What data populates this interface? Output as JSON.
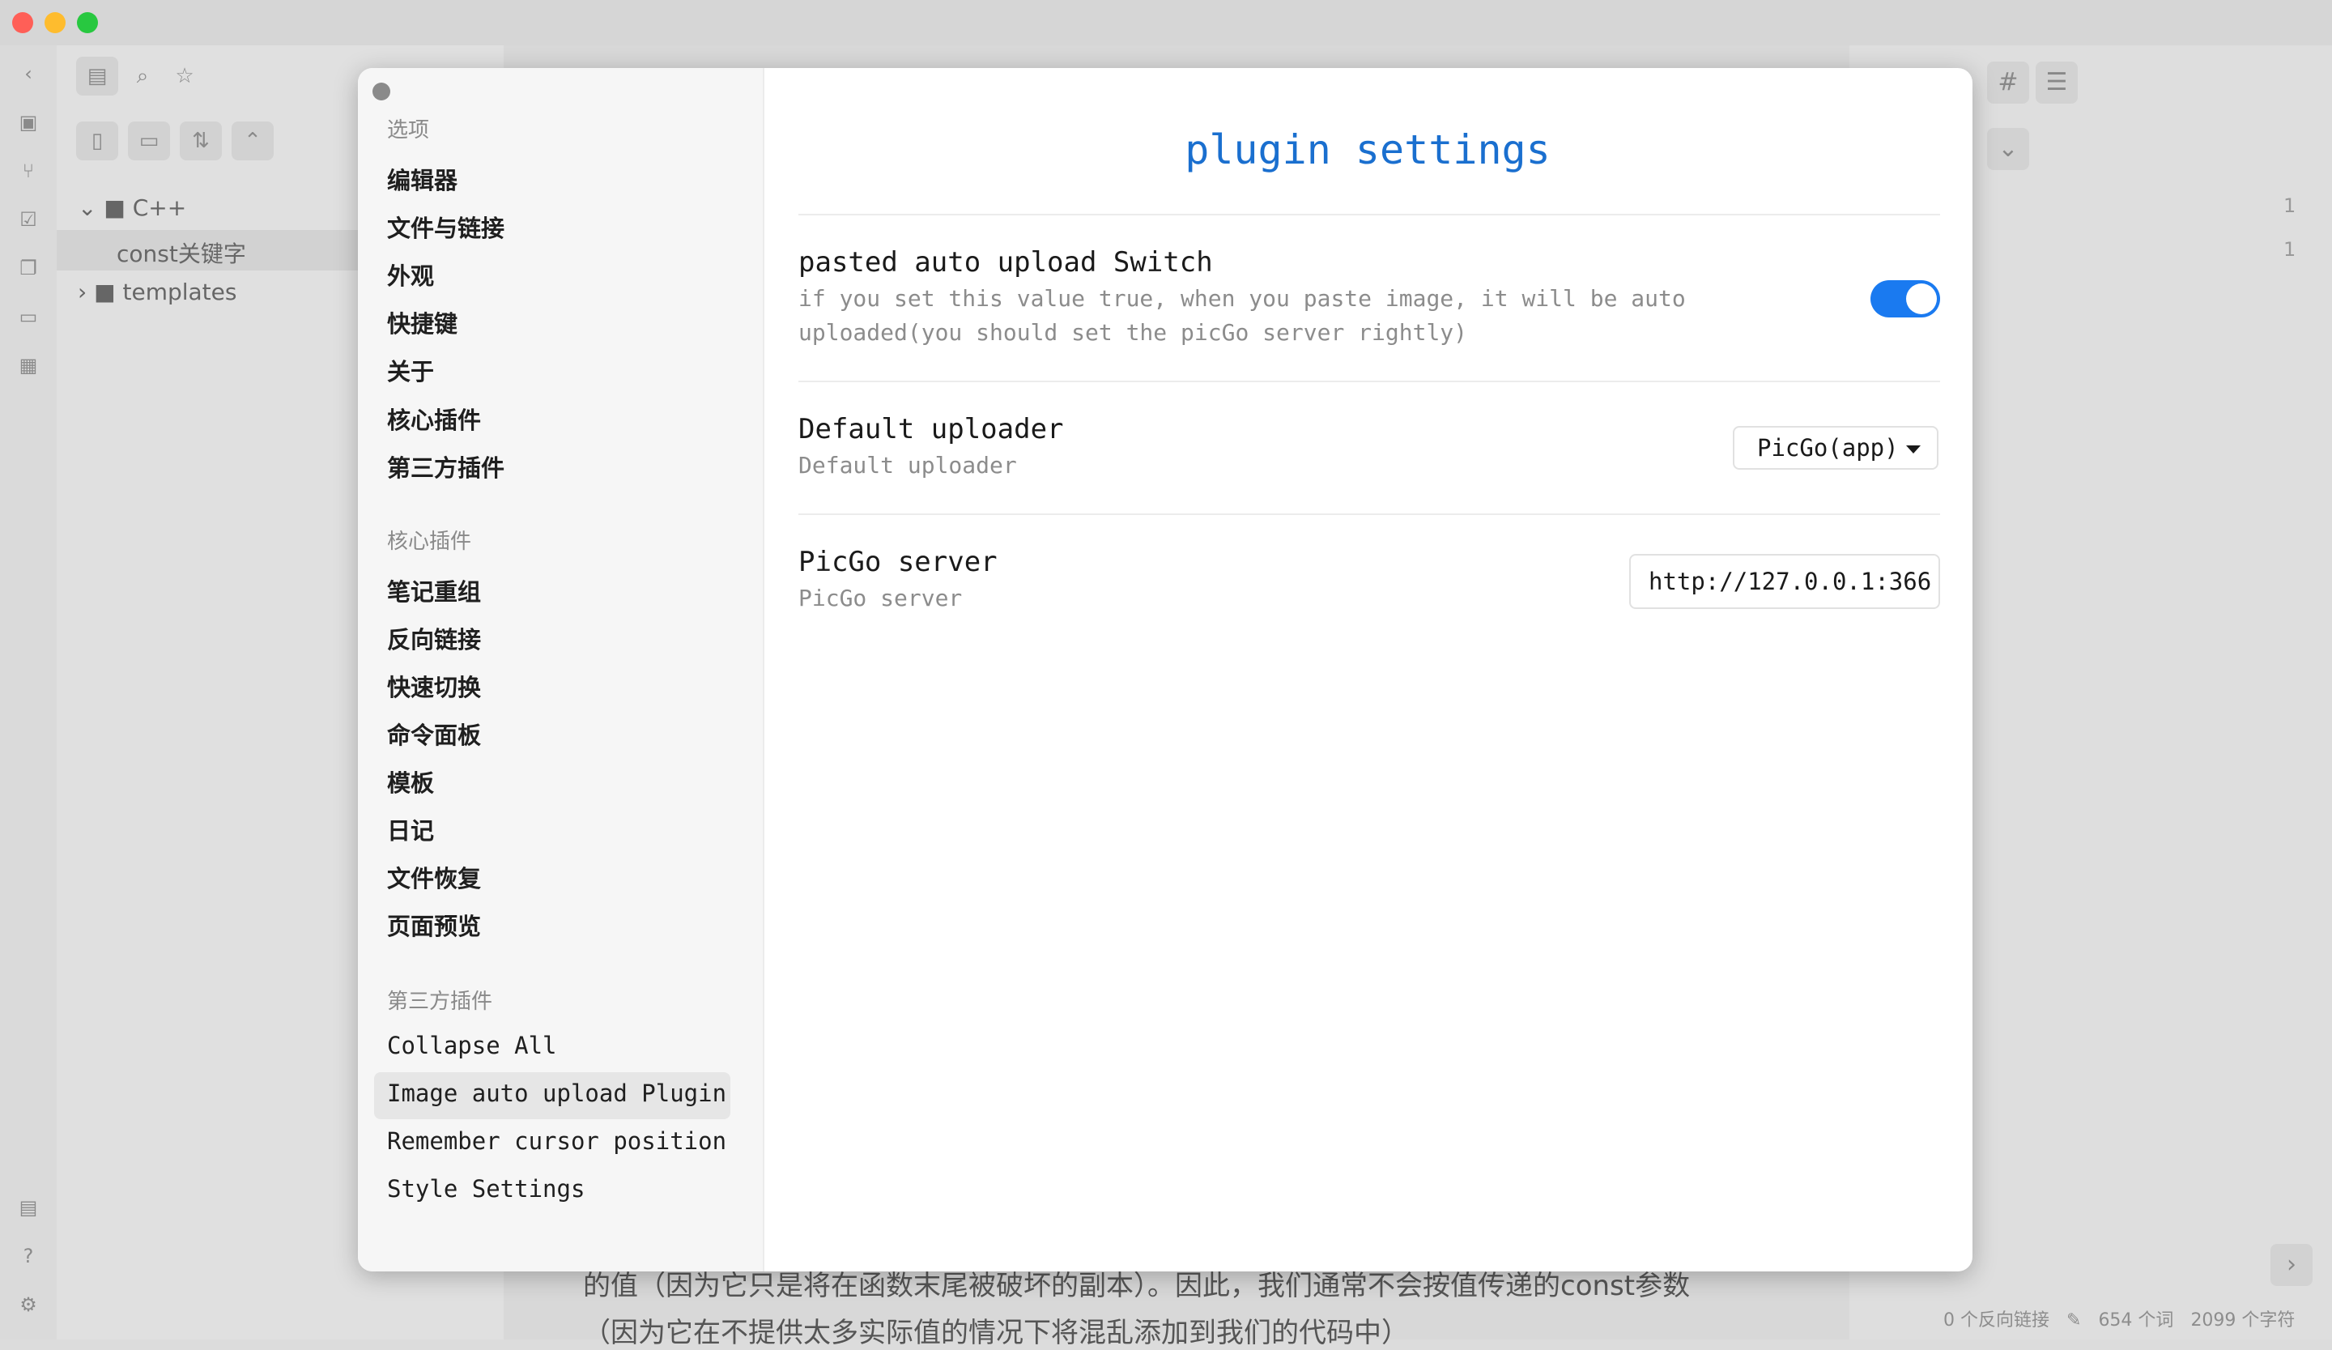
{
  "window": {
    "traffic_colors": [
      "#ff5f57",
      "#febc2e",
      "#28c840"
    ]
  },
  "file_tree": {
    "items": [
      {
        "label": "C++",
        "type": "folder",
        "expanded": true
      },
      {
        "label": "const关键字",
        "type": "file",
        "selected": true
      },
      {
        "label": "templates",
        "type": "folder",
        "expanded": false
      }
    ]
  },
  "editor": {
    "line1": "的值（因为它只是将在函数末尾被破坏的副本）。因此，我们通常不会按值传递的const参数",
    "line2": "（因为它在不提供太多实际值的情况下将混乱添加到我们的代码中）"
  },
  "right_pane": {
    "line_numbers": [
      "1",
      "1"
    ]
  },
  "status_bar": {
    "backlinks": "0 个反向链接",
    "words": "654 个词",
    "chars": "2099 个字符"
  },
  "settings_sidebar": {
    "options_heading": "选项",
    "options": [
      "编辑器",
      "文件与链接",
      "外观",
      "快捷键",
      "关于",
      "核心插件",
      "第三方插件"
    ],
    "core_heading": "核心插件",
    "core_plugins": [
      "笔记重组",
      "反向链接",
      "快速切换",
      "命令面板",
      "模板",
      "日记",
      "文件恢复",
      "页面预览"
    ],
    "community_heading": "第三方插件",
    "community_plugins": [
      "Collapse All",
      "Image auto upload Plugin",
      "Remember cursor position",
      "Style Settings"
    ],
    "active_plugin": "Image auto upload Plugin"
  },
  "plugin_settings": {
    "title": "plugin settings",
    "accent_color": "#1a6fcf",
    "settings": [
      {
        "name": "pasted auto upload Switch",
        "desc": "if you set this value true, when you paste image, it will be auto uploaded(you should set the picGo server rightly)",
        "control": "toggle",
        "value": true
      },
      {
        "name": "Default uploader",
        "desc": "Default uploader",
        "control": "dropdown",
        "value": "PicGo(app)"
      },
      {
        "name": "PicGo server",
        "desc": "PicGo server",
        "control": "text",
        "value": "http://127.0.0.1:366"
      }
    ]
  }
}
